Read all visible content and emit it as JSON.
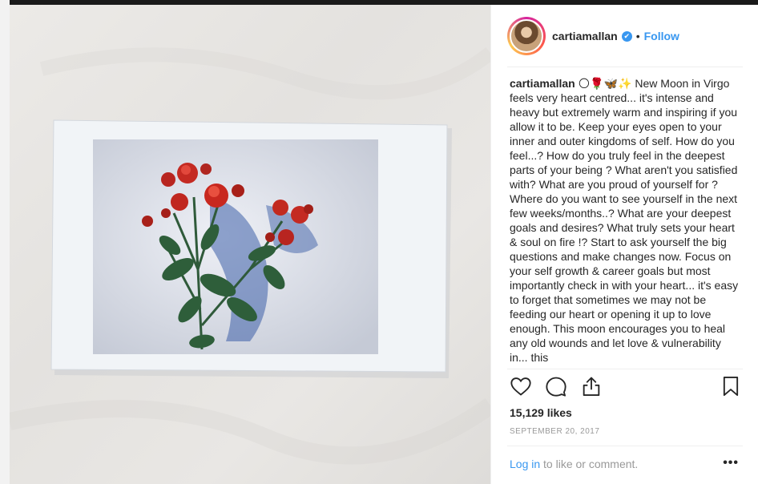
{
  "post": {
    "username": "cartiamallan",
    "verified_glyph": "✔",
    "separator": "•",
    "follow_label": "Follow",
    "caption_user": "cartiamallan",
    "caption_emojis": "🌕🌹🦋✨",
    "caption_text": "New Moon in Virgo feels very heart centred... it's intense and heavy but extremely warm and inspiring if you allow it to be. Keep your eyes open to your inner and outer kingdoms of self. How do you feel...? How do you truly feel in the deepest parts of your being ? What aren't you satisfied with? What are you proud of yourself for ? Where do you want to see yourself in the next few weeks/months..? What are your deepest goals and desires? What truly sets your heart & soul on fire !? Start to ask yourself the big questions and make changes now. Focus on your self growth & career goals but most importantly check in with your heart... it's easy to forget that sometimes we may not be feeding our heart or opening it up to love enough. This moon encourages you to heal any old wounds and let love & vulnerability in... this",
    "likes": "15,129 likes",
    "date": "SEPTEMBER 20, 2017",
    "login_link": "Log in",
    "login_suffix": " to like or comment.",
    "more_glyph": "•••"
  },
  "icons": {
    "heart": "heart-icon",
    "comment": "comment-icon",
    "share": "share-icon",
    "bookmark": "bookmark-icon",
    "verified": "verified-badge-icon"
  },
  "colors": {
    "accent": "#3897f0",
    "text": "#262626",
    "muted": "#999999"
  }
}
